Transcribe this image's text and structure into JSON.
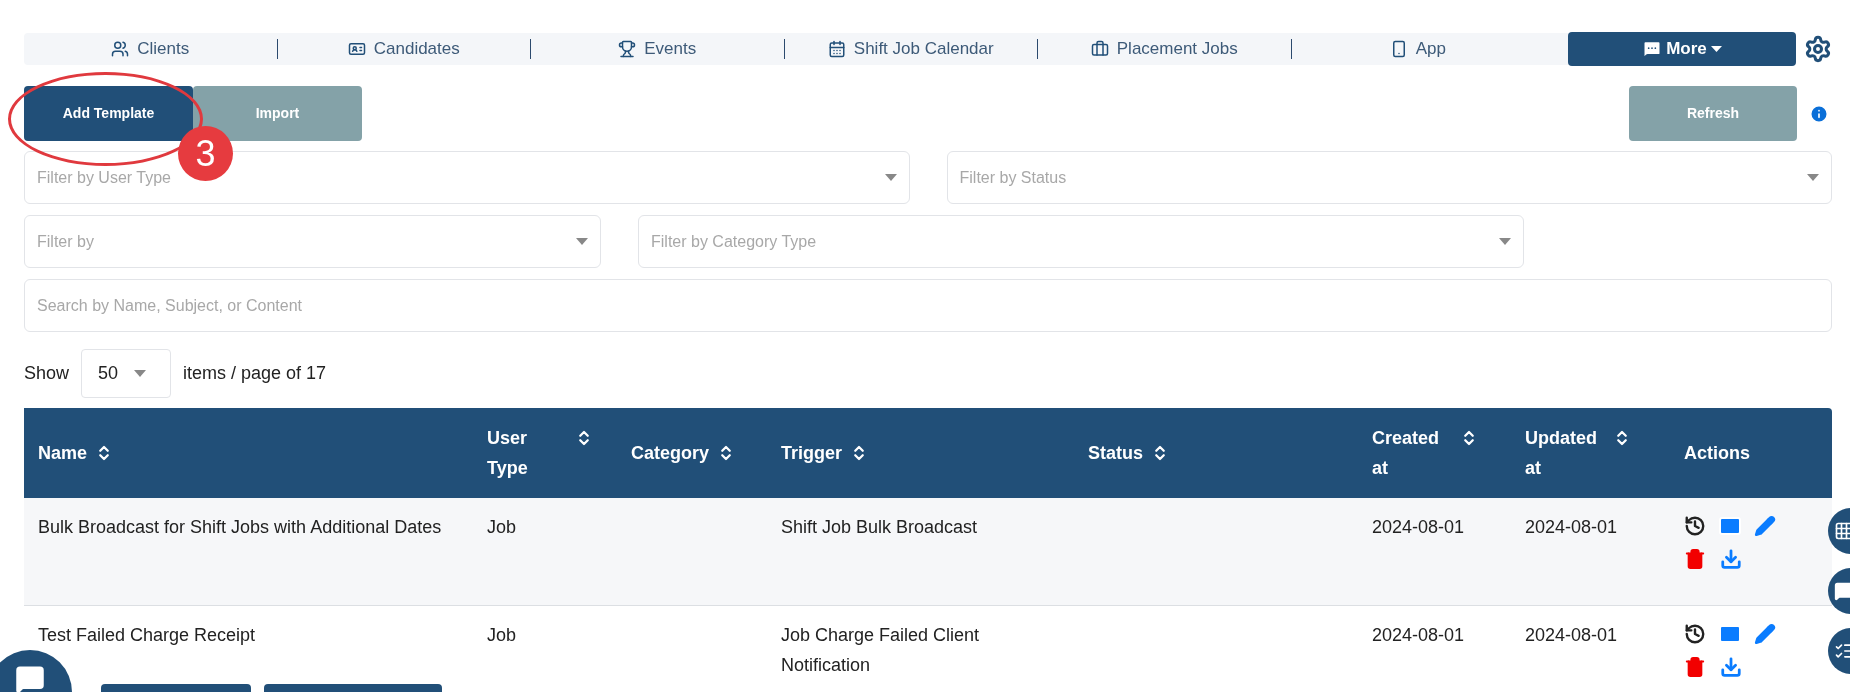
{
  "nav": {
    "tabs": [
      {
        "label": "Clients",
        "selected": false
      },
      {
        "label": "Candidates",
        "selected": false
      },
      {
        "label": "Events",
        "selected": false
      },
      {
        "label": "Shift Job Calendar",
        "selected": false
      },
      {
        "label": "Placement Jobs",
        "selected": false
      },
      {
        "label": "App",
        "selected": false
      }
    ],
    "more": "More"
  },
  "toolbar": {
    "buttons": [
      {
        "label": "Add Template",
        "kind": "primary"
      },
      {
        "label": "Import",
        "kind": "secondary"
      }
    ],
    "refresh": "Refresh"
  },
  "annotation": {
    "number": "3"
  },
  "filters": {
    "user_type": {
      "placeholder": "Filter by User Type"
    },
    "status": {
      "placeholder": "Filter by Status"
    },
    "filter_by": {
      "placeholder": "Filter by"
    },
    "category_type": {
      "placeholder": "Filter by Category Type"
    },
    "search": {
      "placeholder": "Search by Name, Subject, or Content"
    }
  },
  "pagination": {
    "show": "Show",
    "page_size": "50",
    "suffix": "items / page of 17"
  },
  "table": {
    "columns": [
      {
        "label": "Name",
        "sortable": true
      },
      {
        "label": "User Type",
        "sortable": true
      },
      {
        "label": "Category",
        "sortable": true
      },
      {
        "label": "Trigger",
        "sortable": true
      },
      {
        "label": "Status",
        "sortable": true
      },
      {
        "label": "Created at",
        "sortable": true
      },
      {
        "label": "Updated at",
        "sortable": true
      },
      {
        "label": "Actions",
        "sortable": false
      }
    ],
    "rows": [
      {
        "name": "Bulk Broadcast for Shift Jobs with Additional Dates",
        "user_type": "Job",
        "trigger": "Shift Job Bulk Broadcast",
        "created": "2024-08-01",
        "updated": "2024-08-01"
      },
      {
        "name": "Test Failed Charge Receipt",
        "user_type": "Job",
        "trigger": "Job Charge Failed Client Notification",
        "created": "2024-08-01",
        "updated": "2024-08-01"
      }
    ]
  }
}
